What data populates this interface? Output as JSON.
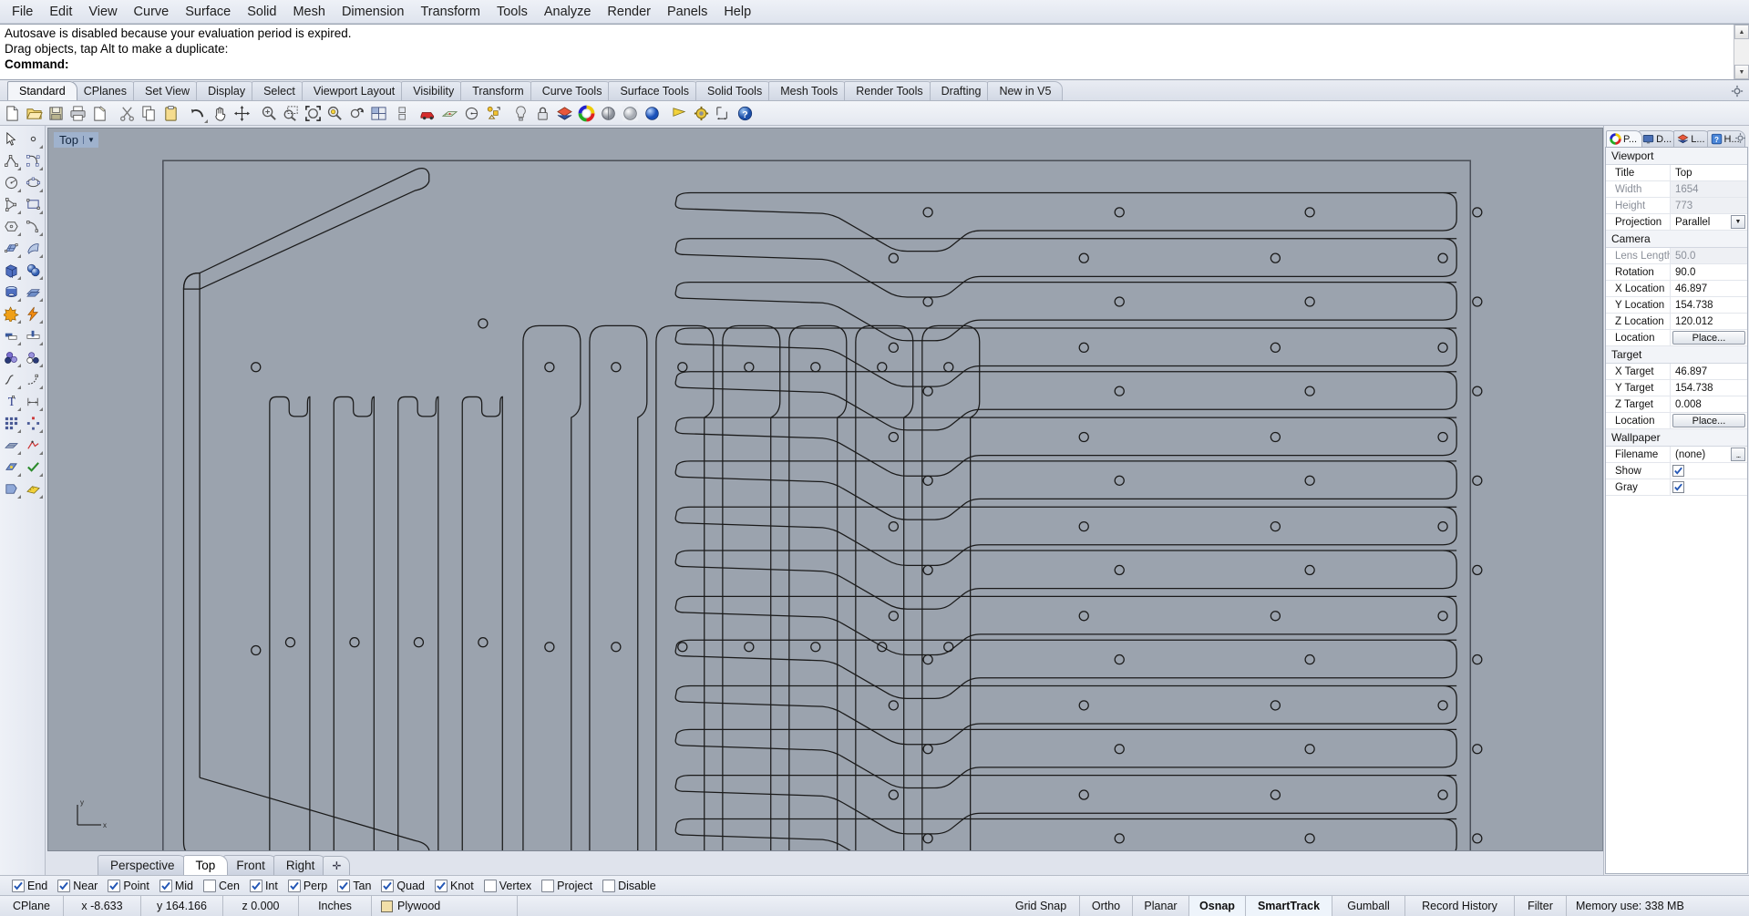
{
  "app": {
    "name": "Rhinoceros"
  },
  "menubar": {
    "items": [
      {
        "label": "File"
      },
      {
        "label": "Edit"
      },
      {
        "label": "View"
      },
      {
        "label": "Curve"
      },
      {
        "label": "Surface"
      },
      {
        "label": "Solid"
      },
      {
        "label": "Mesh"
      },
      {
        "label": "Dimension"
      },
      {
        "label": "Transform"
      },
      {
        "label": "Tools"
      },
      {
        "label": "Analyze"
      },
      {
        "label": "Render"
      },
      {
        "label": "Panels"
      },
      {
        "label": "Help"
      }
    ]
  },
  "command_area": {
    "history": [
      "Autosave is disabled because your evaluation period is expired.",
      "Drag objects, tap Alt to make a duplicate:"
    ],
    "prompt": "Command:",
    "input_value": ""
  },
  "toolbar_tabs": {
    "active": "Standard",
    "items": [
      {
        "label": "Standard"
      },
      {
        "label": "CPlanes"
      },
      {
        "label": "Set View"
      },
      {
        "label": "Display"
      },
      {
        "label": "Select"
      },
      {
        "label": "Viewport Layout"
      },
      {
        "label": "Visibility"
      },
      {
        "label": "Transform"
      },
      {
        "label": "Curve Tools"
      },
      {
        "label": "Surface Tools"
      },
      {
        "label": "Solid Tools"
      },
      {
        "label": "Mesh Tools"
      },
      {
        "label": "Render Tools"
      },
      {
        "label": "Drafting"
      },
      {
        "label": "New in V5"
      }
    ],
    "settings_icon": "gear-icon"
  },
  "icon_toolbar": {
    "items": [
      {
        "icon": "new-file-icon"
      },
      {
        "icon": "open-folder-icon"
      },
      {
        "icon": "save-icon"
      },
      {
        "icon": "print-icon"
      },
      {
        "icon": "save-as-icon"
      },
      {
        "icon": "cut-scissors-icon"
      },
      {
        "icon": "copy-icon"
      },
      {
        "icon": "paste-clipboard-icon"
      },
      {
        "icon": "undo-arrow-icon"
      },
      {
        "icon": "pan-hand-icon"
      },
      {
        "icon": "move-gumball-icon"
      },
      {
        "icon": "zoom-in-icon"
      },
      {
        "icon": "zoom-window-icon"
      },
      {
        "icon": "zoom-extents-icon"
      },
      {
        "icon": "zoom-selected-icon"
      },
      {
        "icon": "rotate-view-icon"
      },
      {
        "icon": "viewport-layout-icon"
      },
      {
        "icon": "named-view-icon"
      },
      {
        "icon": "car-render-icon"
      },
      {
        "icon": "cplane-grid-icon"
      },
      {
        "icon": "circle-center-icon"
      },
      {
        "icon": "object-snap-icon"
      },
      {
        "icon": "light-bulb-icon"
      },
      {
        "icon": "lock-icon"
      },
      {
        "icon": "layers-icon"
      },
      {
        "icon": "color-wheel-icon"
      },
      {
        "icon": "shaded-sphere-icon"
      },
      {
        "icon": "ghosted-sphere-icon"
      },
      {
        "icon": "rendered-sphere-icon"
      },
      {
        "icon": "flag-icon"
      },
      {
        "icon": "options-gear-icon"
      },
      {
        "icon": "dimension-icon"
      },
      {
        "icon": "help-icon"
      }
    ]
  },
  "left_toolbar": {
    "items": [
      {
        "icon": "select-arrow-icon"
      },
      {
        "icon": "point-icon"
      },
      {
        "icon": "polyline-icon"
      },
      {
        "icon": "curve-control-points-icon"
      },
      {
        "icon": "circle-center-radius-icon"
      },
      {
        "icon": "ellipse-icon"
      },
      {
        "icon": "arc-icon"
      },
      {
        "icon": "rectangle-icon"
      },
      {
        "icon": "polygon-icon"
      },
      {
        "icon": "free-form-curve-icon"
      },
      {
        "icon": "surface-edit-points-icon"
      },
      {
        "icon": "surface-sweep-icon"
      },
      {
        "icon": "box-solid-icon"
      },
      {
        "icon": "boolean-union-icon"
      },
      {
        "icon": "cylinder-icon"
      },
      {
        "icon": "mesh-icon"
      },
      {
        "icon": "explode-icon"
      },
      {
        "icon": "lightning-icon"
      },
      {
        "icon": "trim-icon"
      },
      {
        "icon": "split-icon"
      },
      {
        "icon": "layers-color-icon"
      },
      {
        "icon": "object-properties-icon"
      },
      {
        "icon": "blend-curve-icon"
      },
      {
        "icon": "fillet-curve-icon"
      },
      {
        "icon": "text-tool-icon"
      },
      {
        "icon": "dimension-tool-icon"
      },
      {
        "icon": "array-icon"
      },
      {
        "icon": "array-polar-icon"
      },
      {
        "icon": "grid-snap-icon"
      },
      {
        "icon": "analyze-icon"
      },
      {
        "icon": "render-preview-icon"
      },
      {
        "icon": "check-mark-icon"
      },
      {
        "icon": "section-icon"
      },
      {
        "icon": "measure-icon"
      }
    ]
  },
  "viewport": {
    "title": "Top",
    "dropdown_icon": "chevron-down-icon",
    "axis_labels": {
      "x": "x",
      "y": "y"
    },
    "background_color": "#9ba3ae",
    "line_color": "#1a1a1a"
  },
  "viewport_tabs": {
    "active": "Top",
    "items": [
      {
        "label": "Perspective"
      },
      {
        "label": "Top"
      },
      {
        "label": "Front"
      },
      {
        "label": "Right"
      }
    ],
    "add_label": "✛"
  },
  "right_panel": {
    "tabs": [
      {
        "label": "P...",
        "icon": "properties-color-wheel-icon",
        "active": true
      },
      {
        "label": "D...",
        "icon": "display-monitor-icon",
        "active": false
      },
      {
        "label": "L...",
        "icon": "layers-icon",
        "active": false
      },
      {
        "label": "H...",
        "icon": "help-question-icon",
        "active": false
      }
    ],
    "settings_icon": "gear-icon",
    "groups": [
      {
        "title": "Viewport",
        "rows": [
          {
            "label": "Title",
            "value": "Top",
            "kind": "text"
          },
          {
            "label": "Width",
            "value": "1654",
            "kind": "readonly"
          },
          {
            "label": "Height",
            "value": "773",
            "kind": "readonly"
          },
          {
            "label": "Projection",
            "value": "Parallel",
            "kind": "dropdown"
          }
        ]
      },
      {
        "title": "Camera",
        "rows": [
          {
            "label": "Lens Length",
            "value": "50.0",
            "kind": "readonly"
          },
          {
            "label": "Rotation",
            "value": "90.0",
            "kind": "text"
          },
          {
            "label": "X Location",
            "value": "46.897",
            "kind": "text"
          },
          {
            "label": "Y Location",
            "value": "154.738",
            "kind": "text"
          },
          {
            "label": "Z Location",
            "value": "120.012",
            "kind": "text"
          },
          {
            "label": "Location",
            "value": "Place...",
            "kind": "button"
          }
        ]
      },
      {
        "title": "Target",
        "rows": [
          {
            "label": "X Target",
            "value": "46.897",
            "kind": "text"
          },
          {
            "label": "Y Target",
            "value": "154.738",
            "kind": "text"
          },
          {
            "label": "Z Target",
            "value": "0.008",
            "kind": "text"
          },
          {
            "label": "Location",
            "value": "Place...",
            "kind": "button"
          }
        ]
      },
      {
        "title": "Wallpaper",
        "rows": [
          {
            "label": "Filename",
            "value": "(none)",
            "kind": "dots"
          },
          {
            "label": "Show",
            "value": "",
            "kind": "check",
            "checked": true
          },
          {
            "label": "Gray",
            "value": "",
            "kind": "check",
            "checked": true
          }
        ]
      }
    ]
  },
  "osnap_bar": {
    "items": [
      {
        "label": "End",
        "checked": true
      },
      {
        "label": "Near",
        "checked": true
      },
      {
        "label": "Point",
        "checked": true
      },
      {
        "label": "Mid",
        "checked": true
      },
      {
        "label": "Cen",
        "checked": false
      },
      {
        "label": "Int",
        "checked": true
      },
      {
        "label": "Perp",
        "checked": true
      },
      {
        "label": "Tan",
        "checked": true
      },
      {
        "label": "Quad",
        "checked": true
      },
      {
        "label": "Knot",
        "checked": true
      },
      {
        "label": "Vertex",
        "checked": false
      },
      {
        "label": "Project",
        "checked": false
      },
      {
        "label": "Disable",
        "checked": false
      }
    ]
  },
  "status_bar": {
    "cplane_label": "CPlane",
    "x": "x -8.633",
    "y": "y 164.166",
    "z": "z 0.000",
    "units": "Inches",
    "layer": "Plywood",
    "layer_color": "#f2dfa8",
    "toggles": [
      {
        "label": "Grid Snap",
        "active": false
      },
      {
        "label": "Ortho",
        "active": false
      },
      {
        "label": "Planar",
        "active": false
      },
      {
        "label": "Osnap",
        "active": true
      },
      {
        "label": "SmartTrack",
        "active": true
      },
      {
        "label": "Gumball",
        "active": false
      },
      {
        "label": "Record History",
        "active": false
      },
      {
        "label": "Filter",
        "active": false
      }
    ],
    "memory": "Memory use: 338 MB"
  }
}
